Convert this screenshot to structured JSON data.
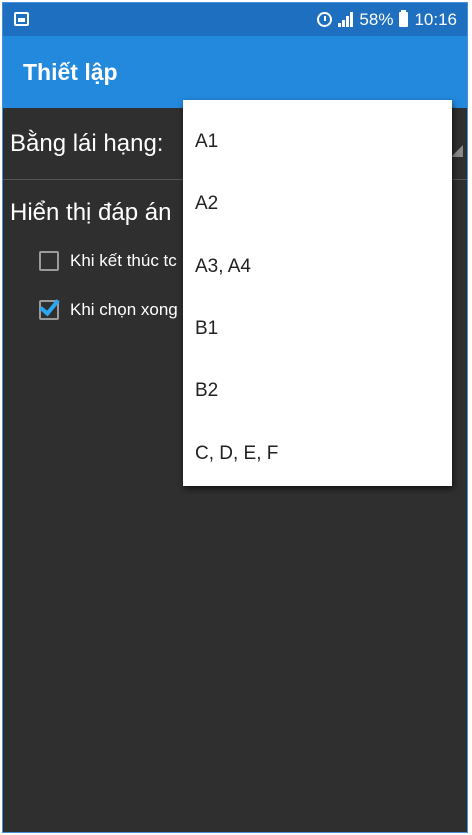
{
  "status_bar": {
    "battery": "58%",
    "time": "10:16",
    "icons": [
      "gallery-icon",
      "alarm-icon",
      "signal-icon",
      "battery-icon"
    ]
  },
  "app_bar": {
    "title": "Thiết lập"
  },
  "license": {
    "label": "Bằng lái hạng:"
  },
  "display": {
    "heading": "Hiển thị đáp án",
    "options": [
      {
        "label": "Khi kết thúc tc",
        "checked": false
      },
      {
        "label": "Khi chọn xong",
        "checked": true
      }
    ]
  },
  "dropdown": {
    "options": [
      "A1",
      "A2",
      "A3, A4",
      "B1",
      "B2",
      "C, D, E, F"
    ]
  },
  "colors": {
    "status_bar": "#1e6fbf",
    "app_bar": "#2389dd",
    "background": "#2f2f2f",
    "checkbox_accent": "#2aa7f0"
  }
}
